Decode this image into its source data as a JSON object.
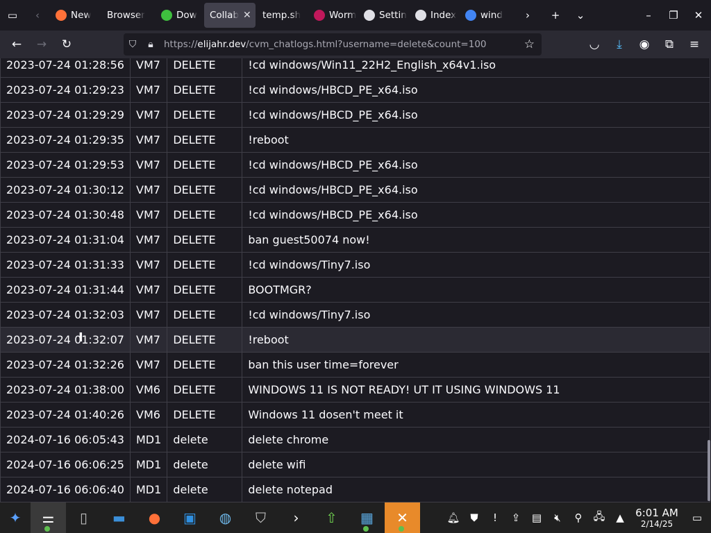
{
  "browser": {
    "tabs": [
      {
        "label": "New",
        "icon": "firefox-icon",
        "color": "#ff7139"
      },
      {
        "label": "Browser",
        "icon": "",
        "color": ""
      },
      {
        "label": "Dow",
        "icon": "download-site-icon",
        "color": "#3fbf3f"
      },
      {
        "label": "Collab",
        "icon": "",
        "color": "",
        "active": true
      },
      {
        "label": "temp.sh",
        "icon": "",
        "color": ""
      },
      {
        "label": "Worm",
        "icon": "worm-icon",
        "color": "#c0185b"
      },
      {
        "label": "Settin",
        "icon": "gear-icon",
        "color": "#e0e0e6"
      },
      {
        "label": "Index",
        "icon": "index-icon",
        "color": "#e0e0e6"
      },
      {
        "label": "wind",
        "icon": "google-icon",
        "color": "#4285f4"
      }
    ],
    "url_prefix": "https://",
    "url_host": "elijahr.dev",
    "url_rest": "/cvm_chatlogs.html?username=delete&count=100"
  },
  "log": {
    "rows": [
      {
        "time": "2023-07-24 01:28:56",
        "vm": "VM7",
        "user": "DELETE",
        "msg": "!cd windows/Win11_22H2_English_x64v1.iso"
      },
      {
        "time": "2023-07-24 01:29:23",
        "vm": "VM7",
        "user": "DELETE",
        "msg": "!cd windows/HBCD_PE_x64.iso"
      },
      {
        "time": "2023-07-24 01:29:29",
        "vm": "VM7",
        "user": "DELETE",
        "msg": "!cd windows/HBCD_PE_x64.iso"
      },
      {
        "time": "2023-07-24 01:29:35",
        "vm": "VM7",
        "user": "DELETE",
        "msg": "!reboot"
      },
      {
        "time": "2023-07-24 01:29:53",
        "vm": "VM7",
        "user": "DELETE",
        "msg": "!cd windows/HBCD_PE_x64.iso"
      },
      {
        "time": "2023-07-24 01:30:12",
        "vm": "VM7",
        "user": "DELETE",
        "msg": "!cd windows/HBCD_PE_x64.iso"
      },
      {
        "time": "2023-07-24 01:30:48",
        "vm": "VM7",
        "user": "DELETE",
        "msg": "!cd windows/HBCD_PE_x64.iso"
      },
      {
        "time": "2023-07-24 01:31:04",
        "vm": "VM7",
        "user": "DELETE",
        "msg": "ban guest50074 now!"
      },
      {
        "time": "2023-07-24 01:31:33",
        "vm": "VM7",
        "user": "DELETE",
        "msg": "!cd windows/Tiny7.iso"
      },
      {
        "time": "2023-07-24 01:31:44",
        "vm": "VM7",
        "user": "DELETE",
        "msg": "BOOTMGR?"
      },
      {
        "time": "2023-07-24 01:32:03",
        "vm": "VM7",
        "user": "DELETE",
        "msg": "!cd windows/Tiny7.iso"
      },
      {
        "time": "2023-07-24 01:32:07",
        "vm": "VM7",
        "user": "DELETE",
        "msg": "!reboot",
        "hover": true
      },
      {
        "time": "2023-07-24 01:32:26",
        "vm": "VM7",
        "user": "DELETE",
        "msg": "ban this user time=forever"
      },
      {
        "time": "2023-07-24 01:38:00",
        "vm": "VM6",
        "user": "DELETE",
        "msg": "WINDOWS 11 IS NOT READY! UT IT USING WINDOWS 11"
      },
      {
        "time": "2023-07-24 01:40:26",
        "vm": "VM6",
        "user": "DELETE",
        "msg": "Windows 11 dosen't meet it"
      },
      {
        "time": "2024-07-16 06:05:43",
        "vm": "MD1",
        "user": "delete",
        "msg": "delete chrome"
      },
      {
        "time": "2024-07-16 06:06:25",
        "vm": "MD1",
        "user": "delete",
        "msg": "delete wifi"
      },
      {
        "time": "2024-07-16 06:06:40",
        "vm": "MD1",
        "user": "delete",
        "msg": "delete notepad"
      }
    ]
  },
  "taskbar": {
    "apps": [
      {
        "name": "start-icon",
        "glyph": "✦",
        "color": "#5aa0ff"
      },
      {
        "name": "control-panel-icon",
        "glyph": "⚌",
        "color": "#ffffff",
        "active": true,
        "dot": true
      },
      {
        "name": "blank-file-icon",
        "glyph": "▯",
        "color": "#bbbbbb"
      },
      {
        "name": "file-explorer-icon",
        "glyph": "▬",
        "color": "#3b8fd9"
      },
      {
        "name": "firefox-icon",
        "glyph": "●",
        "color": "#ff7139"
      },
      {
        "name": "store-icon",
        "glyph": "▣",
        "color": "#2f8fe0"
      },
      {
        "name": "globe-icon",
        "glyph": "◍",
        "color": "#6fb7e8"
      },
      {
        "name": "shield-icon",
        "glyph": "⛉",
        "color": "#cccccc"
      },
      {
        "name": "terminal-icon",
        "glyph": "›",
        "color": "#ffffff"
      },
      {
        "name": "upload-icon",
        "glyph": "⇧",
        "color": "#6fcf4f"
      },
      {
        "name": "vmware-icon",
        "glyph": "▦",
        "color": "#5aa9e0",
        "dot": true
      },
      {
        "name": "x-app-icon",
        "glyph": "✕",
        "color": "#ffffff",
        "bg": "#e88a2a",
        "dot": true
      }
    ],
    "time": "6:01 AM",
    "date": "2/14/25"
  }
}
